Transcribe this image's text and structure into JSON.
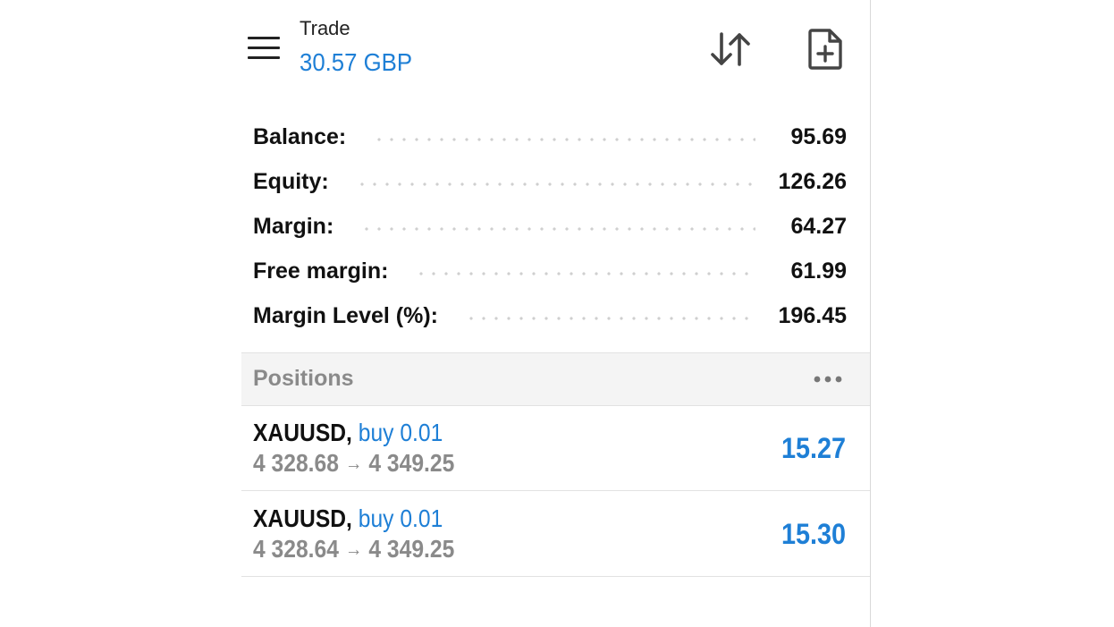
{
  "header": {
    "title": "Trade",
    "subtitle": "30.57 GBP",
    "menu_icon": "hamburger-menu-icon",
    "sort_icon": "sort-arrows-icon",
    "new_order_icon": "new-order-document-icon"
  },
  "summary": [
    {
      "label": "Balance:",
      "value": "95.69"
    },
    {
      "label": "Equity:",
      "value": "126.26"
    },
    {
      "label": "Margin:",
      "value": "64.27"
    },
    {
      "label": "Free margin:",
      "value": "61.99"
    },
    {
      "label": "Margin Level (%):",
      "value": "196.45"
    }
  ],
  "positions": {
    "title": "Positions",
    "more_icon": "more-dots-icon",
    "items": [
      {
        "symbol": "XAUUSD,",
        "type": "buy 0.01",
        "open_price": "4 328.68",
        "arrow": "→",
        "current_price": "4 349.25",
        "profit": "15.27"
      },
      {
        "symbol": "XAUUSD,",
        "type": "buy 0.01",
        "open_price": "4 328.64",
        "arrow": "→",
        "current_price": "4 349.25",
        "profit": "15.30"
      }
    ]
  },
  "colors": {
    "accent": "#1e7fd6",
    "text": "#111111",
    "muted": "#8a8a8a",
    "section_bg": "#f4f4f4"
  }
}
